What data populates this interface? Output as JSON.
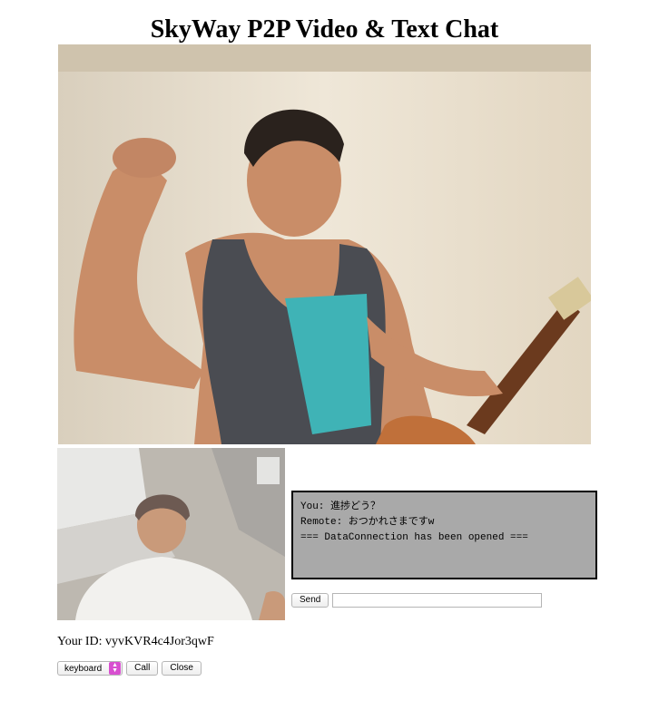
{
  "page": {
    "title": "SkyWay P2P Video & Text Chat"
  },
  "remote_video": {
    "icon": "video-stream-remote"
  },
  "local_video": {
    "icon": "video-stream-local"
  },
  "chat": {
    "messages": [
      "You: 進捗どう？",
      "Remote: おつかれさまですw",
      "=== DataConnection has been opened ==="
    ],
    "send_label": "Send",
    "input_value": ""
  },
  "peer": {
    "your_id_text": "Your ID: vyvKVR4c4Jor3qwF"
  },
  "controls": {
    "select_value": "keyboard",
    "call_label": "Call",
    "close_label": "Close",
    "select_accent": "#d84fd0"
  }
}
